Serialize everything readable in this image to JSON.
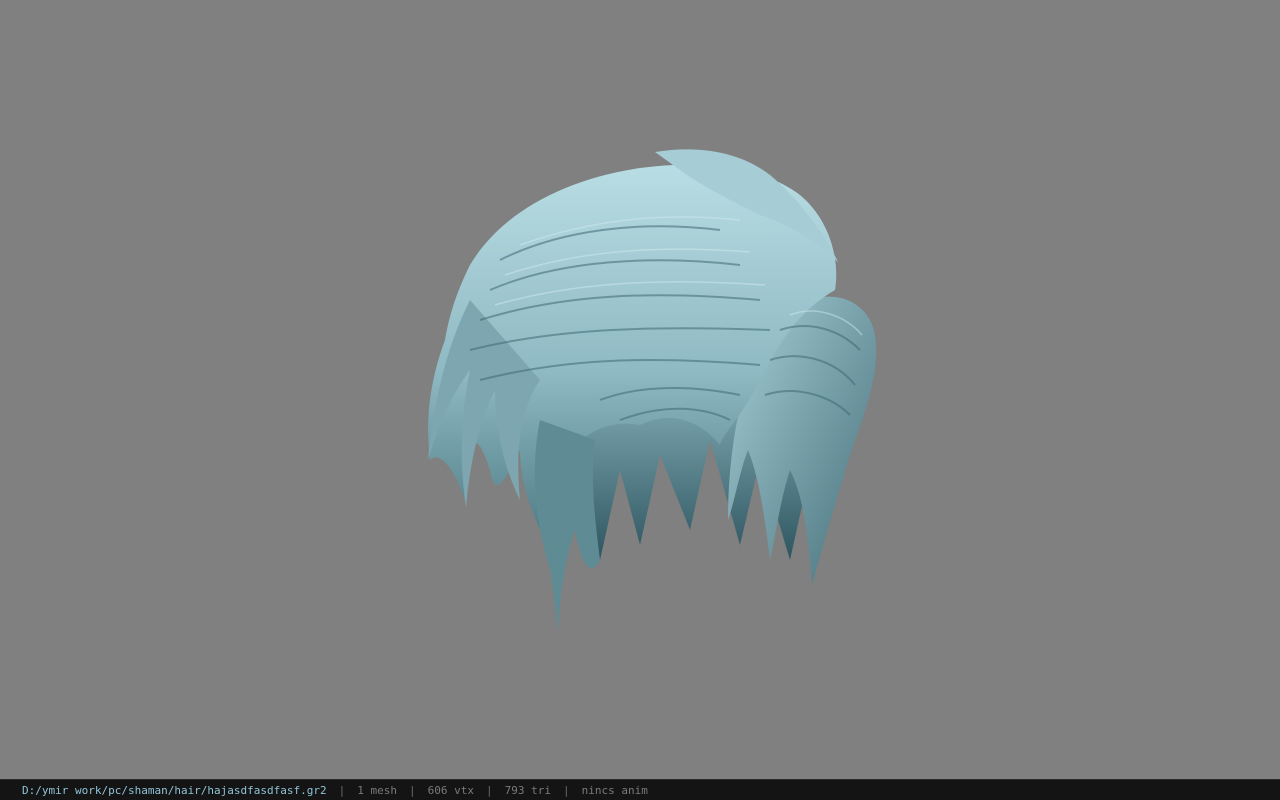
{
  "viewer": {
    "background_color": "#808080",
    "model_icon": "hair-mesh-icon",
    "model_tint": "#a9cdd6"
  },
  "statusbar": {
    "file_path": "D:/ymir work/pc/shaman/hair/hajasdfasdfasf.gr2",
    "separator": "|",
    "mesh_count": "1 mesh",
    "vertex_count": "606 vtx",
    "triangle_count": "793 tri",
    "anim_status": "nincs anim"
  }
}
